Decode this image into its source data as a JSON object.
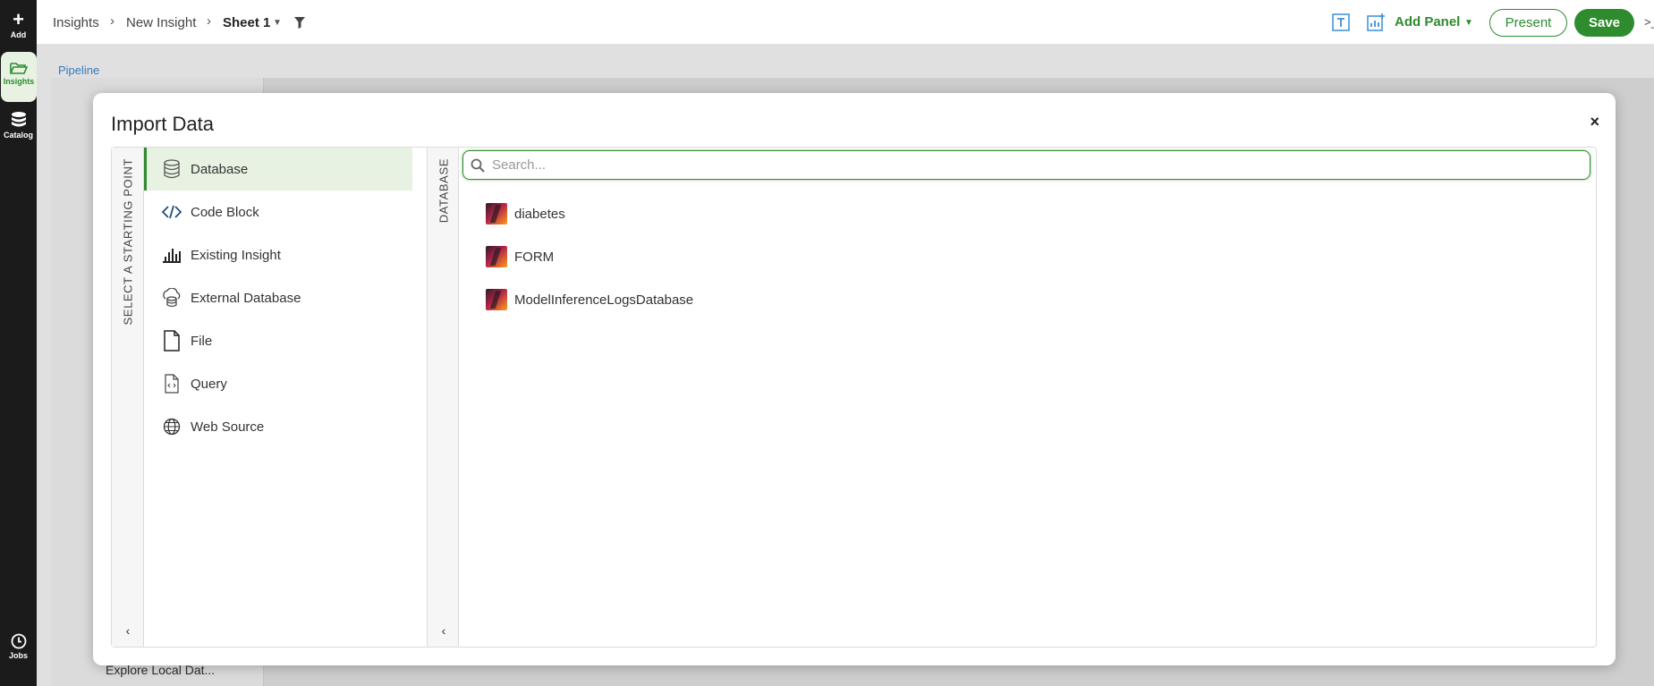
{
  "rail": {
    "add_label": "Add",
    "insights_label": "Insights",
    "catalog_label": "Catalog",
    "jobs_label": "Jobs"
  },
  "breadcrumb": {
    "items": [
      "Insights",
      "New Insight",
      "Sheet 1"
    ]
  },
  "toolbar": {
    "add_panel_label": "Add Panel",
    "present_label": "Present",
    "save_label": "Save",
    "more_glyph": ">_"
  },
  "background": {
    "pipeline_label": "Pipeline",
    "explore_text": "Explore Local Dat..."
  },
  "modal": {
    "title": "Import Data",
    "close_glyph": "×",
    "starting_point_label": "SELECT A STARTING POINT",
    "database_col_label": "DATABASE",
    "options": [
      {
        "label": "Database",
        "icon": "database-icon",
        "active": true
      },
      {
        "label": "Code Block",
        "icon": "code-icon",
        "active": false
      },
      {
        "label": "Existing Insight",
        "icon": "bar-chart-icon",
        "active": false
      },
      {
        "label": "External Database",
        "icon": "cloud-database-icon",
        "active": false
      },
      {
        "label": "File",
        "icon": "file-icon",
        "active": false
      },
      {
        "label": "Query",
        "icon": "query-file-icon",
        "active": false
      },
      {
        "label": "Web Source",
        "icon": "globe-icon",
        "active": false
      }
    ],
    "search": {
      "placeholder": "Search...",
      "value": ""
    },
    "databases": [
      "diabetes",
      "FORM",
      "ModelInferenceLogsDatabase"
    ]
  },
  "colors": {
    "accent": "#2e8b2e",
    "rail_bg": "#1b1b1b",
    "active_bg": "#e8f2e2",
    "link": "#3a8fd6"
  }
}
